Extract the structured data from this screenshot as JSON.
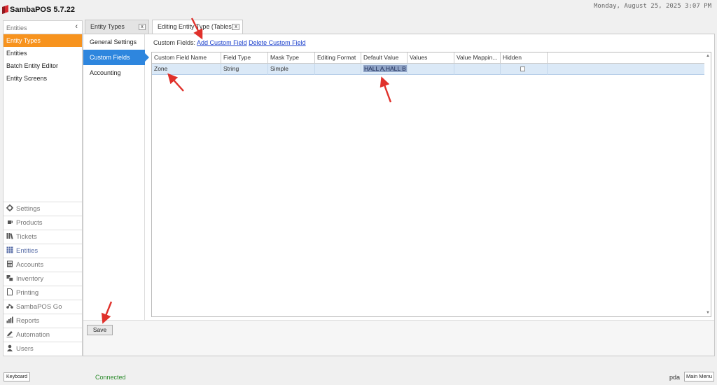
{
  "app": {
    "title": "SambaPOS 5.7.22",
    "datetime": "Monday, August 25, 2025 3:07 PM",
    "brand_color": "#d9282f"
  },
  "sidebar": {
    "header": "Entities",
    "collapse_glyph": "‹",
    "items": [
      {
        "label": "Entity Types",
        "active": true
      },
      {
        "label": "Entities"
      },
      {
        "label": "Batch Entity Editor"
      },
      {
        "label": "Entity Screens"
      }
    ],
    "nav": [
      {
        "label": "Settings",
        "icon": "gear-icon"
      },
      {
        "label": "Products",
        "icon": "cup-icon"
      },
      {
        "label": "Tickets",
        "icon": "books-icon"
      },
      {
        "label": "Entities",
        "icon": "table-icon",
        "active": true
      },
      {
        "label": "Accounts",
        "icon": "calculator-icon"
      },
      {
        "label": "Inventory",
        "icon": "boxes-icon"
      },
      {
        "label": "Printing",
        "icon": "document-icon"
      },
      {
        "label": "SambaPOS Go",
        "icon": "motorbike-icon"
      },
      {
        "label": "Reports",
        "icon": "bar-chart-icon"
      },
      {
        "label": "Automation",
        "icon": "pencil-icon"
      },
      {
        "label": "Users",
        "icon": "user-icon"
      }
    ]
  },
  "tabs": [
    {
      "label": "Entity Types",
      "close": "x"
    },
    {
      "label": "Editing Entity Type (Tables)",
      "close": "x",
      "active": true
    }
  ],
  "editor": {
    "menu": [
      {
        "label": "General Settings"
      },
      {
        "label": "Custom Fields",
        "active": true
      },
      {
        "label": "Accounting"
      }
    ],
    "custom_fields_label": "Custom Fields:",
    "add_link": "Add Custom Field",
    "delete_link": "Delete Custom Field",
    "columns": [
      "Custom Field Name",
      "Field Type",
      "Mask Type",
      "Editing Format",
      "Default Value",
      "Values",
      "Value Mappin...",
      "Hidden"
    ],
    "rows": [
      {
        "name": "Zone",
        "field_type": "String",
        "mask_type": "Simple",
        "editing_format": "",
        "default_value": "HALL A,HALL B",
        "values": "",
        "value_mapping": "",
        "hidden": false
      }
    ],
    "save_label": "Save"
  },
  "status": {
    "keyboard": "Keyboard",
    "connection": "Connected",
    "user": "pda",
    "main_menu": "Main Menu"
  }
}
